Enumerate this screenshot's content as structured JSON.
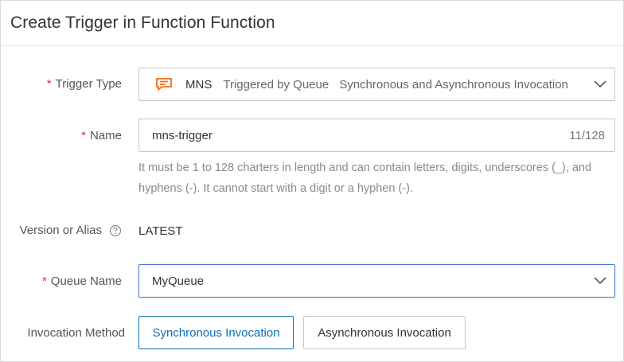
{
  "dialog": {
    "title": "Create Trigger in Function Function"
  },
  "form": {
    "trigger_type": {
      "label": "Trigger Type",
      "required_mark": "*",
      "icon": "mns-icon",
      "value_name": "MNS",
      "value_desc": "Triggered by Queue",
      "value_mode": "Synchronous and Asynchronous Invocation"
    },
    "name": {
      "label": "Name",
      "required_mark": "*",
      "value": "mns-trigger",
      "counter": "11/128",
      "help": "It must be 1 to 128 charters in length and can contain letters, digits, underscores (_), and hyphens (-). It cannot start with a digit or a hyphen (-)."
    },
    "version": {
      "label": "Version or Alias",
      "icon": "question-circle-icon",
      "value": "LATEST"
    },
    "queue": {
      "label": "Queue Name",
      "required_mark": "*",
      "value": "MyQueue"
    },
    "invocation": {
      "label": "Invocation Method",
      "options": [
        {
          "label": "Synchronous Invocation",
          "selected": true
        },
        {
          "label": "Asynchronous Invocation",
          "selected": false
        }
      ]
    }
  },
  "colors": {
    "required": "#d93026",
    "accent": "#0b6fb5",
    "mns_icon": "#f26b1d",
    "focus_border": "#4a78d6"
  }
}
